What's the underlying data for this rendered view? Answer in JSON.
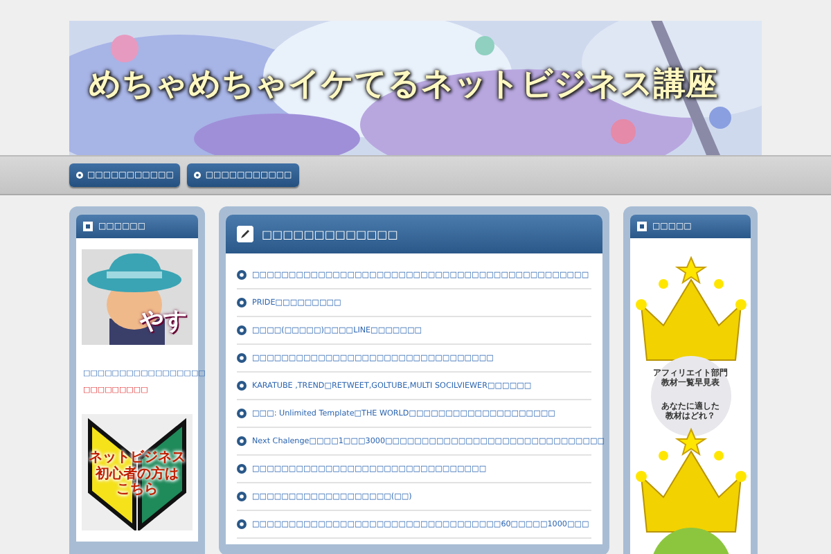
{
  "banner": {
    "title": "めちゃめちゃイケてるネットビジネス講座"
  },
  "nav": [
    {
      "label": "□□□□□□□□□□□"
    },
    {
      "label": "□□□□□□□□□□□"
    }
  ],
  "left_widget": {
    "title": "□□□□□□",
    "avatar_caption": "やす",
    "profile_link": "□□□□□□□□□□□□□□□□□",
    "red_note": "□□□□□□□□□",
    "beginner_banner": [
      "ネットビジネス",
      "初心者の方は",
      "こちら"
    ]
  },
  "main": {
    "title": "□□□□□□□□□□□□□",
    "posts": [
      "□□□□□□□□□□□□□□□□□□□□□□□□□□□□□□□□□□□□□□□□□□□□□□",
      "PRIDE□□□□□□□□□",
      "□□□□(□□□□□)□□□□LINE□□□□□□□",
      "□□□□□□□□□□□□□□□□□□□□□□□□□□□□□□□□□",
      "KARATUBE ,TREND□RETWEET,GOLTUBE,MULTI SOCILVIEWER□□□□□□",
      "□□□: Unlimited Template□THE WORLD□□□□□□□□□□□□□□□□□□□□",
      "Next Chalenge□□□□1□□□3000□□□□□□□□□□□□□□□□□□□□□□□□□□□□□□",
      "□□□□□□□□□□□□□□□□□□□□□□□□□□□□□□□□",
      "□□□□□□□□□□□□□□□□□□□(□□)",
      "□□□□□□□□□□□□□□□□□□□□□□□□□□□□□□□□□□60□□□□□1000□□□"
    ]
  },
  "right_widget": {
    "title": "□□□□□",
    "ranking_banners": [
      {
        "color": "#e8e8ec",
        "heading_lines": [
          "アフィリエイト部門",
          "教材一覧早見表"
        ],
        "question_lines": [
          "あなたに適した",
          "教材はどれ？"
        ]
      },
      {
        "color": "#8cc63f"
      }
    ]
  }
}
